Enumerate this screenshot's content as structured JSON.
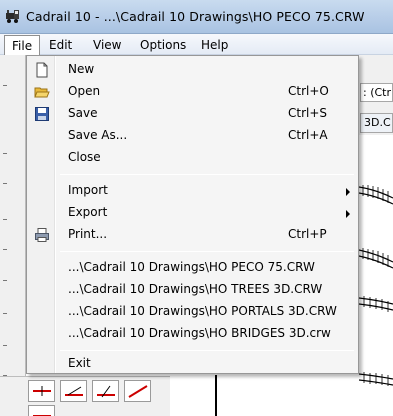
{
  "window": {
    "title": "Cadrail 10 - ...\\Cadrail 10 Drawings\\HO PECO 75.CRW"
  },
  "menubar": {
    "items": [
      "File",
      "Edit",
      "View",
      "Options",
      "Help"
    ],
    "active": "File"
  },
  "file_menu": {
    "items": [
      {
        "label": "New",
        "accel": "",
        "icon": "new-document-icon"
      },
      {
        "label": "Open",
        "accel": "Ctrl+O",
        "icon": "open-folder-icon"
      },
      {
        "label": "Save",
        "accel": "Ctrl+S",
        "icon": "floppy-disk-icon"
      },
      {
        "label": "Save As...",
        "accel": "Ctrl+A"
      },
      {
        "label": "Close",
        "accel": ""
      },
      {
        "label": "Import",
        "accel": "",
        "submenu": true
      },
      {
        "label": "Export",
        "accel": "",
        "submenu": true
      },
      {
        "label": "Print...",
        "accel": "Ctrl+P",
        "icon": "printer-icon"
      },
      {
        "label": "...\\Cadrail 10 Drawings\\HO PECO 75.CRW"
      },
      {
        "label": "...\\Cadrail 10 Drawings\\HO TREES 3D.CRW"
      },
      {
        "label": "...\\Cadrail 10 Drawings\\HO PORTALS 3D.CRW"
      },
      {
        "label": "...\\Cadrail 10 Drawings\\HO BRIDGES 3D.crw"
      },
      {
        "label": "Exit",
        "accel": ""
      }
    ]
  },
  "background": {
    "field_text": ": (Ctrl",
    "field2_text": "3D.C"
  },
  "colors": {
    "titlebar": "#b7cde8",
    "menu_background": "#f5f5f5",
    "accent_red": "#cc0000",
    "icon_blue": "#3a5fa8",
    "folder_yellow": "#e8b93a"
  }
}
